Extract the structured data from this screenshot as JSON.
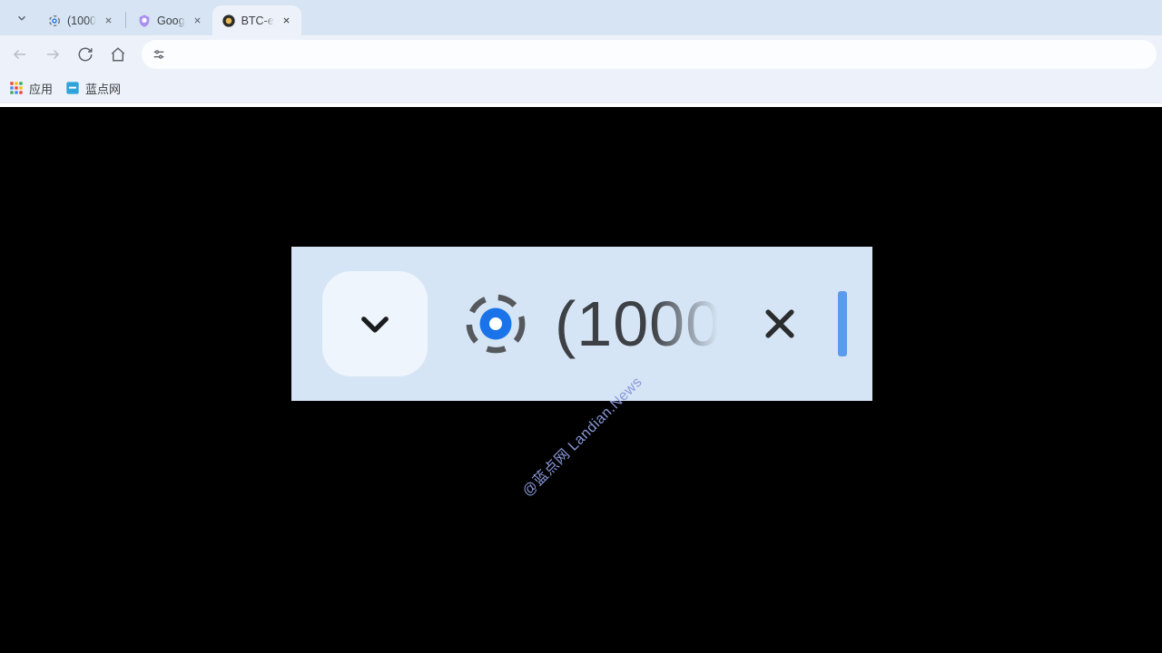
{
  "tabs": [
    {
      "title": "(1000",
      "active": false,
      "favicon": "loading1"
    },
    {
      "title": "Goog",
      "active": false,
      "favicon": "shield"
    },
    {
      "title": "BTC-e",
      "active": true,
      "favicon": "gold"
    }
  ],
  "bookmarks": [
    {
      "label": "应用",
      "icon": "apps"
    },
    {
      "label": "蓝点网",
      "icon": "blue"
    }
  ],
  "zoom": {
    "text": "(1000"
  },
  "watermark": "@蓝点网 Landian.News"
}
